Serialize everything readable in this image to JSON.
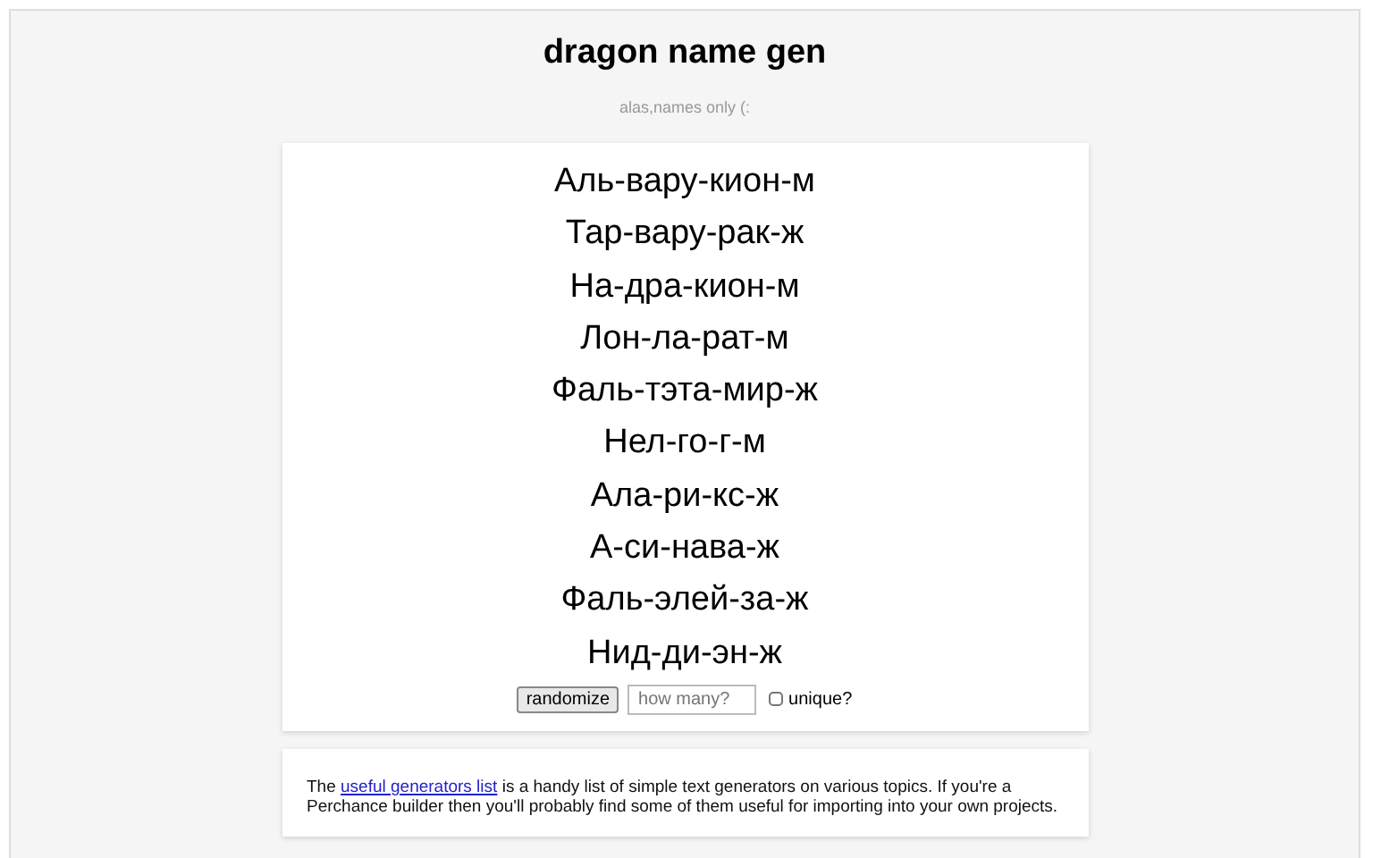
{
  "title": "dragon name gen",
  "subtitle": "alas,names only (:",
  "names": [
    "Аль-вару-кион-м",
    "Тар-вару-рак-ж",
    "На-дра-кион-м",
    "Лон-ла-рат-м",
    "Фаль-тэта-мир-ж",
    "Нел-го-г-м",
    "Ала-ри-кс-ж",
    "А-си-нава-ж",
    "Фаль-элей-за-ж",
    "Нид-ди-эн-ж"
  ],
  "controls": {
    "button": "randomize",
    "count_placeholder": "how many?",
    "unique": {
      "label": "unique?",
      "checked": false
    }
  },
  "info": {
    "before": "The ",
    "link": "useful generators list",
    "after": " is a handy list of simple text generators on various topics. If you're a Perchance builder then you'll probably find some of them useful for importing into your own projects."
  }
}
